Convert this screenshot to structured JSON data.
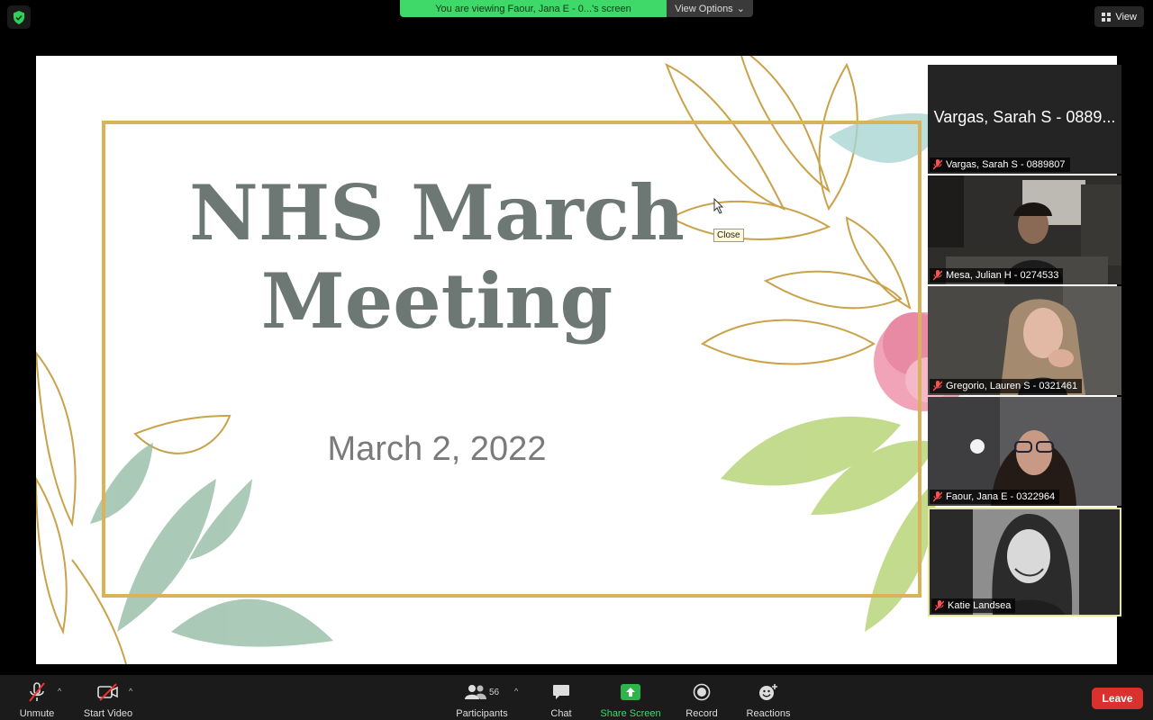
{
  "banner": {
    "text": "You are viewing Faour, Jana E - 0...'s screen",
    "view_options": "View Options"
  },
  "view_button": "View",
  "slide": {
    "title_line1": "NHS March",
    "title_line2": "Meeting",
    "date": "March 2, 2022",
    "tooltip": "Close"
  },
  "gallery": [
    {
      "big_name": "Vargas, Sarah S - 0889...",
      "label": "Vargas, Sarah S - 0889807",
      "muted": true
    },
    {
      "label": "Mesa, Julian H - 0274533",
      "muted": true
    },
    {
      "label": "Gregorio, Lauren S - 0321461",
      "muted": true
    },
    {
      "label": "Faour, Jana E - 0322964",
      "muted": true
    },
    {
      "label": "Katie Landsea",
      "muted": true,
      "active": true
    }
  ],
  "toolbar": {
    "unmute": "Unmute",
    "start_video": "Start Video",
    "participants": "Participants",
    "participant_count": "56",
    "chat": "Chat",
    "share_screen": "Share Screen",
    "record": "Record",
    "reactions": "Reactions",
    "leave": "Leave"
  },
  "colors": {
    "banner": "#3fd96a",
    "leave": "#d9312e",
    "share": "#2db54c",
    "slide_title": "#6d7774",
    "gold": "#d8b35a",
    "active_tile": "#e4e49a"
  }
}
